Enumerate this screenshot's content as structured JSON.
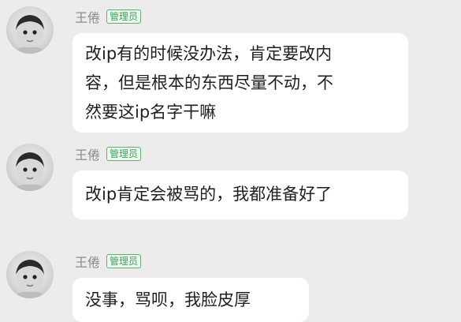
{
  "messages": [
    {
      "sender": "王倦",
      "role_badge": "管理员",
      "lines": [
        "改ip有的时候没办法，肯定要改内",
        "容，但是根本的东西尽量不动，不",
        "然要这ip名字干嘛"
      ]
    },
    {
      "sender": "王倦",
      "role_badge": "管理员",
      "lines": [
        "改ip肯定会被骂的，我都准备好了"
      ]
    },
    {
      "sender": "王倦",
      "role_badge": "管理员",
      "lines": [
        "没事，骂呗，我脸皮厚"
      ]
    }
  ],
  "colors": {
    "background": "#ececec",
    "bubble": "#ffffff",
    "badge_green": "#3fa35a",
    "name_gray": "#8a8a8a"
  },
  "icons": {
    "avatar": "baby-photo-avatar"
  }
}
